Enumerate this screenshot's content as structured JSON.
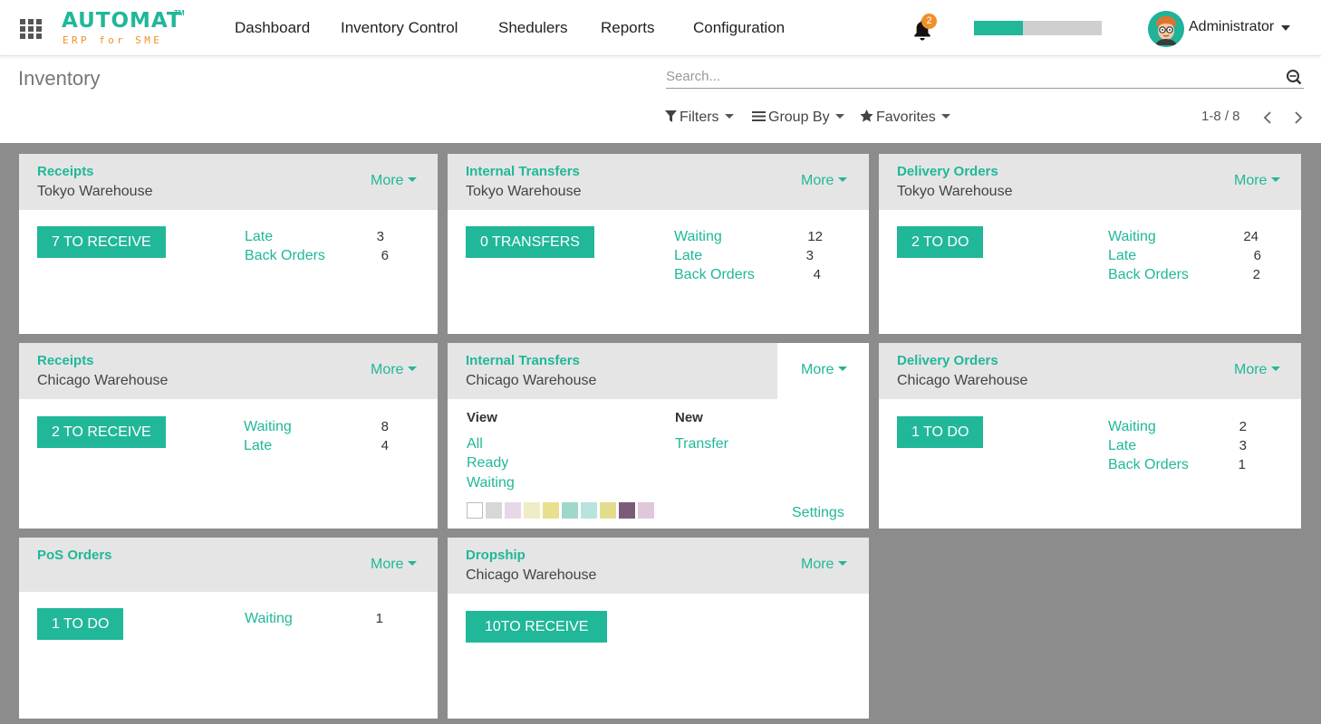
{
  "brand": {
    "name": "AUTOMAT",
    "tm": "TM",
    "tagline": "ERP for SME"
  },
  "nav": [
    {
      "label": "Dashboard"
    },
    {
      "label": "Inventory Control"
    },
    {
      "label": "Shedulers"
    },
    {
      "label": "Reports"
    },
    {
      "label": "Configuration"
    }
  ],
  "notifications": {
    "count": "2"
  },
  "activity_progress": 0.38,
  "user": {
    "name": "Administrator"
  },
  "page": {
    "title": "Inventory"
  },
  "search": {
    "placeholder": "Search..."
  },
  "controls": {
    "filters": "Filters",
    "group_by": "Group By",
    "favorites": "Favorites"
  },
  "pager": {
    "value": "1-8 / 8"
  },
  "more_label": "More",
  "cards": [
    {
      "title": "Receipts",
      "subtitle": "Tokyo Warehouse",
      "button": "7 TO RECEIVE",
      "stats": [
        {
          "label": "Late",
          "value": "3"
        },
        {
          "label": "Back Orders",
          "value": "6"
        }
      ]
    },
    {
      "title": "Internal Transfers",
      "subtitle": "Tokyo Warehouse",
      "button": "0 TRANSFERS",
      "stats": [
        {
          "label": "Waiting",
          "value": "12"
        },
        {
          "label": "Late",
          "value": "3"
        },
        {
          "label": "Back Orders",
          "value": "4"
        }
      ]
    },
    {
      "title": "Delivery Orders",
      "subtitle": "Tokyo Warehouse",
      "button": "2 TO DO",
      "stats": [
        {
          "label": "Waiting",
          "value": "24"
        },
        {
          "label": "Late",
          "value": "6"
        },
        {
          "label": "Back Orders",
          "value": "2"
        }
      ]
    },
    {
      "title": "Receipts",
      "subtitle": "Chicago Warehouse",
      "button": "2 TO RECEIVE",
      "stats": [
        {
          "label": "Waiting",
          "value": "8"
        },
        {
          "label": "Late",
          "value": "4"
        }
      ]
    },
    {
      "title": "Internal Transfers",
      "subtitle": "Chicago Warehouse",
      "view_heading": "View",
      "view_links": [
        "All",
        "Ready",
        "Waiting"
      ],
      "new_heading": "New",
      "new_links": [
        "Transfer"
      ],
      "settings_label": "Settings",
      "colors": [
        "#ffffff",
        "#d7d7d7",
        "#e8d7e6",
        "#efecc6",
        "#e8e08e",
        "#9fd7c9",
        "#b7e4df",
        "#e2dc8d",
        "#7a5c78",
        "#dfc8dc"
      ]
    },
    {
      "title": "Delivery Orders",
      "subtitle": "Chicago Warehouse",
      "button": "1 TO DO",
      "stats": [
        {
          "label": "Waiting",
          "value": "2"
        },
        {
          "label": "Late",
          "value": "3"
        },
        {
          "label": "Back Orders",
          "value": "1"
        }
      ]
    },
    {
      "title": "PoS Orders",
      "subtitle": "",
      "button": "1 TO DO",
      "stats": [
        {
          "label": "Waiting",
          "value": "1"
        }
      ]
    },
    {
      "title": "Dropship",
      "subtitle": "Chicago Warehouse",
      "button": "10TO RECEIVE",
      "stats": []
    }
  ],
  "colors": {
    "accent": "#21b799",
    "badge": "#f0902a",
    "board": "#8c8c8c"
  }
}
